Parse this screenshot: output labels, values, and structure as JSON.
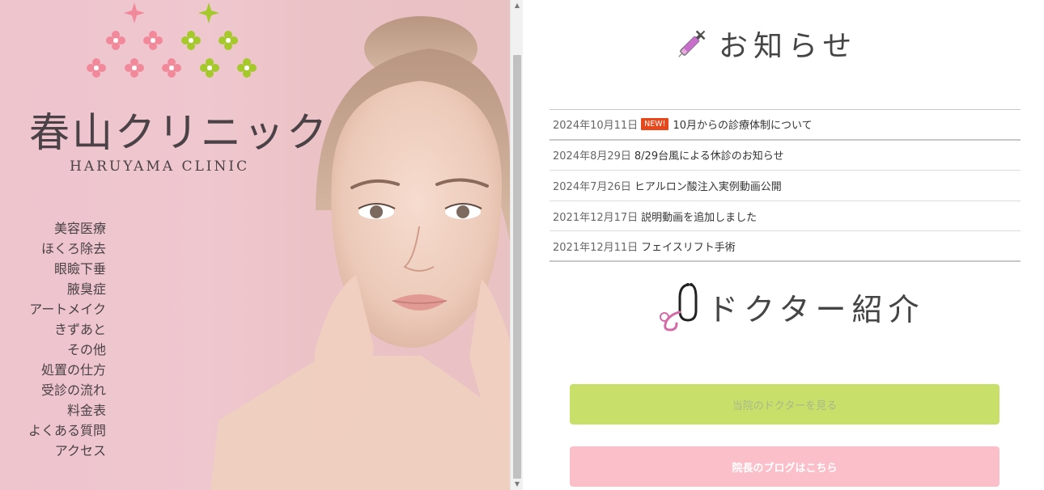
{
  "clinic": {
    "name_jp": "春山クリニック",
    "name_en": "HARUYAMA CLINIC"
  },
  "nav": {
    "items": [
      {
        "label": "美容医療"
      },
      {
        "label": "ほくろ除去"
      },
      {
        "label": "眼瞼下垂"
      },
      {
        "label": "腋臭症"
      },
      {
        "label": "アートメイク"
      },
      {
        "label": "きずあと"
      },
      {
        "label": "その他"
      },
      {
        "label": "処置の仕方"
      },
      {
        "label": "受診の流れ"
      },
      {
        "label": "料金表"
      },
      {
        "label": "よくある質問"
      },
      {
        "label": "アクセス"
      }
    ]
  },
  "news": {
    "heading": "お知らせ",
    "icon": "syringe-icon",
    "items": [
      {
        "date": "2024年10月11日",
        "badge": "NEW!",
        "title": "10月からの診療体制について"
      },
      {
        "date": "2024年8月29日",
        "badge": "",
        "title": "8/29台風による休診のお知らせ"
      },
      {
        "date": "2024年7月26日",
        "badge": "",
        "title": "ヒアルロン酸注入実例動画公開"
      },
      {
        "date": "2021年12月17日",
        "badge": "",
        "title": "説明動画を追加しました"
      },
      {
        "date": "2021年12月11日",
        "badge": "",
        "title": "フェイスリフト手術"
      }
    ]
  },
  "doctor": {
    "heading": "ドクター紹介",
    "icon": "stethoscope-icon"
  },
  "buttons": {
    "doctor_label": "当院のドクターを見る",
    "blog_label": "院長のブログはこちら"
  },
  "colors": {
    "hero_background": "#eec4cd",
    "pink_accent": "#f2899b",
    "green_accent": "#a5c92a",
    "badge_red": "#e8471b",
    "doctor_button": "#c8e06a",
    "blog_button": "#fbbfca"
  }
}
